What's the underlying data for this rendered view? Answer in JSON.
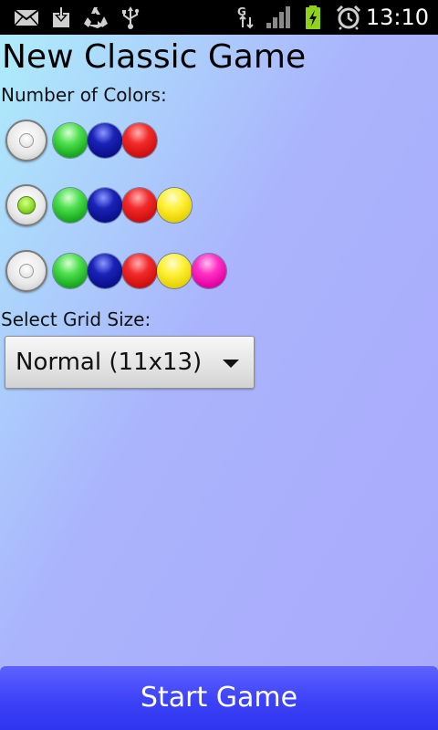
{
  "status_bar": {
    "time": "13:10",
    "icons": [
      "mail-icon",
      "download-icon",
      "recycle-icon",
      "usb-icon",
      "gprs-icon",
      "signal-icon",
      "battery-charging-icon",
      "alarm-icon"
    ]
  },
  "screen": {
    "title": "New Classic Game",
    "colors_label": "Number of Colors:",
    "grid_label": "Select Grid Size:"
  },
  "color_options": [
    {
      "colors": [
        "green",
        "blue",
        "red"
      ],
      "checked": false
    },
    {
      "colors": [
        "green",
        "blue",
        "red",
        "yellow"
      ],
      "checked": true
    },
    {
      "colors": [
        "green",
        "blue",
        "red",
        "yellow",
        "pink"
      ],
      "checked": false
    }
  ],
  "grid_size": {
    "selected": "Normal (11x13)"
  },
  "start_button": {
    "label": "Start Game"
  },
  "colors": {
    "status_bar_bg": "#000000",
    "button_bg": "#3c42f7",
    "battery": "#8fd21b"
  }
}
